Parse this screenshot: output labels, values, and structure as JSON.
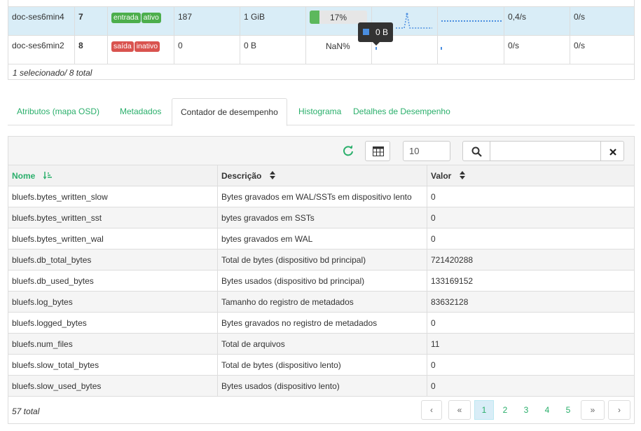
{
  "osd_rows": [
    {
      "host": "doc-ses6min4",
      "id": "7",
      "status": [
        "entrada",
        "ativo"
      ],
      "status_colors": [
        "#4cae4c",
        "#4cae4c"
      ],
      "pgs": "187",
      "size": "1 GiB",
      "usage_label": "17%",
      "usage": 0.17,
      "read_rate": "0,4/s",
      "write_rate": "0/s"
    },
    {
      "host": "doc-ses6min2",
      "id": "8",
      "status": [
        "saída",
        "inativo"
      ],
      "status_colors": [
        "#d9534f",
        "#d9534f"
      ],
      "pgs": "0",
      "size": "0 B",
      "usage_label": "NaN%",
      "read_rate": "0/s",
      "write_rate": "0/s"
    }
  ],
  "selection_summary": "1 selecionado/ 8 total",
  "tooltip_value": "0 B",
  "tabs": [
    {
      "label": "Atributos (mapa OSD)"
    },
    {
      "label": "Metadados"
    },
    {
      "label": "Contador de desempenho"
    },
    {
      "label": "Histograma"
    },
    {
      "label": "Detalhes de Desempenho"
    }
  ],
  "active_tab": "Contador de desempenho",
  "toolbar": {
    "refresh_icon": "refresh-icon",
    "columns_icon": "table-columns-icon",
    "page_size": "10",
    "search_icon": "search-icon",
    "search_value": "",
    "clear_icon": "close-icon"
  },
  "columns": [
    "Nome",
    "Descrição",
    "Valor"
  ],
  "rows": [
    {
      "name": "bluefs.bytes_written_slow",
      "desc": "Bytes gravados em WAL/SSTs em dispositivo lento",
      "value": "0"
    },
    {
      "name": "bluefs.bytes_written_sst",
      "desc": "bytes gravados em SSTs",
      "value": "0"
    },
    {
      "name": "bluefs.bytes_written_wal",
      "desc": "bytes gravados em WAL",
      "value": "0"
    },
    {
      "name": "bluefs.db_total_bytes",
      "desc": "Total de bytes (dispositivo bd principal)",
      "value": "721420288"
    },
    {
      "name": "bluefs.db_used_bytes",
      "desc": "Bytes usados (dispositivo bd principal)",
      "value": "133169152"
    },
    {
      "name": "bluefs.log_bytes",
      "desc": "Tamanho do registro de metadados",
      "value": "83632128"
    },
    {
      "name": "bluefs.logged_bytes",
      "desc": "Bytes gravados no registro de metadados",
      "value": "0"
    },
    {
      "name": "bluefs.num_files",
      "desc": "Total de arquivos",
      "value": "11"
    },
    {
      "name": "bluefs.slow_total_bytes",
      "desc": "Total de bytes (dispositivo lento)",
      "value": "0"
    },
    {
      "name": "bluefs.slow_used_bytes",
      "desc": "Bytes usados (dispositivo lento)",
      "value": "0"
    }
  ],
  "total_text": "57 total",
  "pagination": {
    "prev": "‹",
    "first": "«",
    "pages": [
      "1",
      "2",
      "3",
      "4",
      "5"
    ],
    "next_block": "»",
    "next": "›",
    "current": "1"
  },
  "accent_color": "#2aaf6b",
  "selected_row_color": "#d9edf7"
}
